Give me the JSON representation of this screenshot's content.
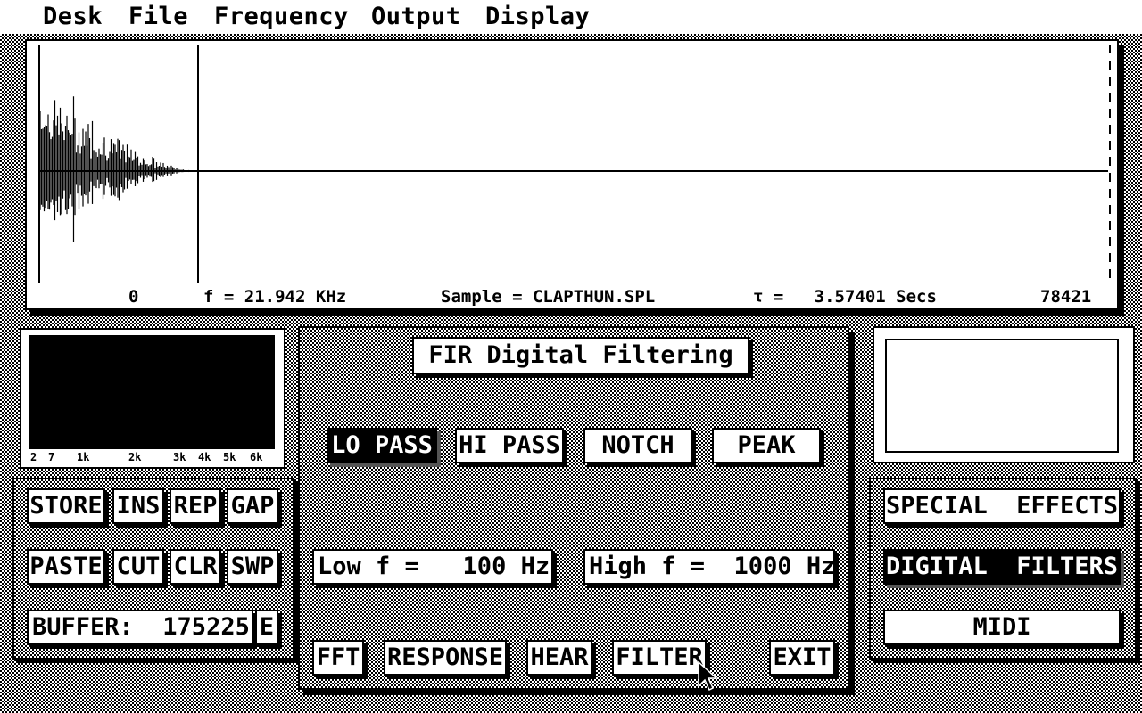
{
  "menu": {
    "items": [
      {
        "label": "Desk"
      },
      {
        "label": "File"
      },
      {
        "label": "Frequency"
      },
      {
        "label": "Output"
      },
      {
        "label": "Display"
      }
    ]
  },
  "waveform": {
    "start_label": "0",
    "freq_label": "f = 21.942 KHz",
    "sample_label": "Sample = CLAPTHUN.SPL",
    "time_label": "τ =   3.57401 Secs",
    "end_label": "78421"
  },
  "spectrum": {
    "ticks": [
      "2",
      "7",
      "1k",
      "2k",
      "3k",
      "4k",
      "5k",
      "6k"
    ]
  },
  "edit_buttons": {
    "store": "STORE",
    "ins": "INS",
    "rep": "REP",
    "gap": "GAP",
    "paste": "PASTE",
    "cut": "CUT",
    "clr": "CLR",
    "swp": "SWP",
    "buffer": "BUFFER:  175225",
    "e": "E"
  },
  "filter": {
    "title": "FIR Digital Filtering",
    "types": {
      "lo_pass": "LO PASS",
      "hi_pass": "HI PASS",
      "notch": "NOTCH",
      "peak": "PEAK"
    },
    "selected_type": "LO PASS",
    "low_f": "Low f =   100 Hz",
    "high_f": "High f =  1000 Hz",
    "actions": {
      "fft": "FFT",
      "response": "RESPONSE",
      "hear": "HEAR",
      "filter": "FILTER",
      "exit": "EXIT"
    }
  },
  "modes": {
    "special_effects": "SPECIAL  EFFECTS",
    "digital_filters": "DIGITAL  FILTERS",
    "midi": "MIDI",
    "selected": "DIGITAL  FILTERS"
  }
}
